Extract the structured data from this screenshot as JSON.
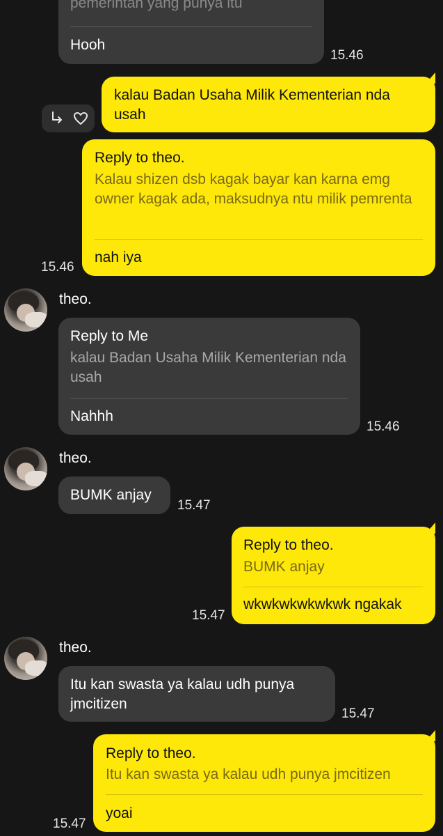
{
  "messages": {
    "m1": {
      "partial_quote": "pemerintah yang punya itu",
      "text": "Hooh",
      "time": "15.46"
    },
    "m2": {
      "text": "kalau Badan Usaha Milik Kementerian nda usah"
    },
    "m3": {
      "reply_header": "Reply to theo.",
      "quote": "Kalau shizen dsb kagak bayar kan karna emg owner kagak ada, maksudnya ntu milik pemrenta",
      "text": "nah iya",
      "time": "15.46"
    },
    "m4": {
      "sender": "theo.",
      "reply_header": "Reply to Me",
      "quote": "kalau Badan Usaha Milik Kementerian nda usah",
      "text": "Nahhh",
      "time": "15.46"
    },
    "m5": {
      "sender": "theo.",
      "text": "BUMK anjay",
      "time": "15.47"
    },
    "m6": {
      "reply_header": "Reply to theo.",
      "quote": "BUMK anjay",
      "text": "wkwkwkwkwkwk ngakak",
      "time": "15.47"
    },
    "m7": {
      "sender": "theo.",
      "text": "Itu kan swasta ya kalau udh punya jmcitizen",
      "time": "15.47"
    },
    "m8": {
      "reply_header": "Reply to theo.",
      "quote": "Itu kan swasta ya kalau udh punya jmcitizen",
      "text": "yoai",
      "time": "15.47"
    }
  },
  "icons": {
    "reply": "reply-arrow-icon",
    "like": "heart-icon"
  },
  "colors": {
    "background": "#161616",
    "incoming": "#3a3a3a",
    "outgoing": "#fde80a"
  }
}
